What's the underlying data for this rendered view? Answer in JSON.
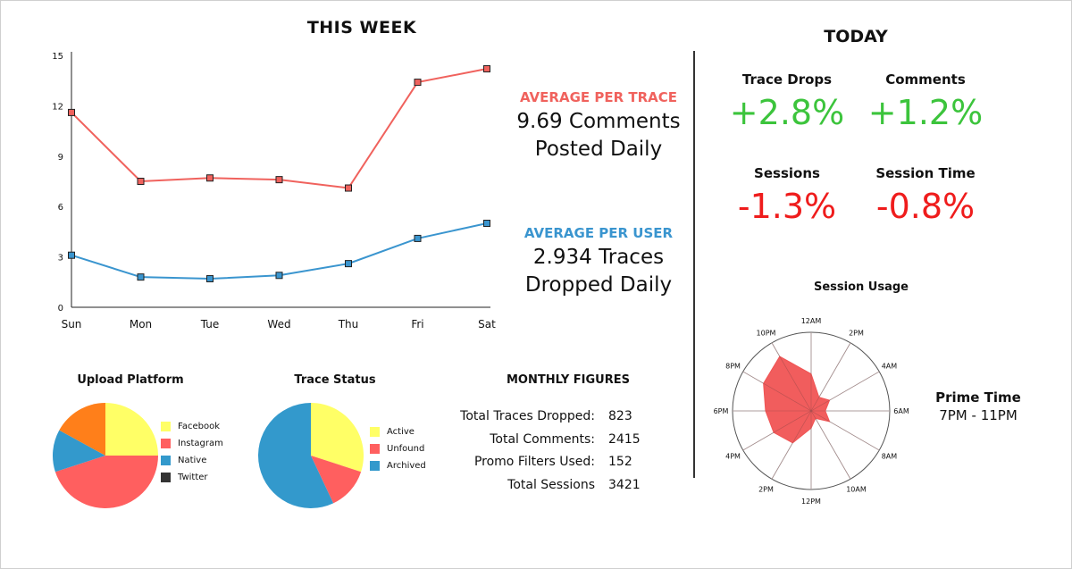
{
  "week_title": "THIS WEEK",
  "today_title": "TODAY",
  "avg_trace": {
    "label": "AVERAGE PER TRACE",
    "line1": "9.69 Comments",
    "line2": "Posted Daily",
    "color": "#f0625d"
  },
  "avg_user": {
    "label": "AVERAGE PER USER",
    "line1": "2.934 Traces",
    "line2": "Dropped Daily",
    "color": "#3a95cf"
  },
  "kpis": [
    {
      "label": "Trace Drops",
      "value": "+2.8%",
      "color": "#3cc43c"
    },
    {
      "label": "Comments",
      "value": "+1.2%",
      "color": "#3cc43c"
    },
    {
      "label": "Sessions",
      "value": "-1.3%",
      "color": "#ef1c1c"
    },
    {
      "label": "Session Time",
      "value": "-0.8%",
      "color": "#ef1c1c"
    }
  ],
  "monthly": {
    "title": "MONTHLY FIGURES",
    "rows": [
      {
        "label": "Total Traces Dropped:",
        "value": "823"
      },
      {
        "label": "Total Comments:",
        "value": "2415"
      },
      {
        "label": "Promo Filters Used:",
        "value": "152"
      },
      {
        "label": "Total Sessions",
        "value": "3421"
      }
    ]
  },
  "prime": {
    "title": "Prime Time",
    "value": "7PM - 11PM"
  },
  "chart_data": [
    {
      "type": "line",
      "categories": [
        "Sun",
        "Mon",
        "Tue",
        "Wed",
        "Thu",
        "Fri",
        "Sat"
      ],
      "y_ticks": [
        "0",
        "3",
        "6",
        "9",
        "12",
        "15"
      ],
      "ylim": [
        0,
        15
      ],
      "grid": false,
      "series": [
        {
          "values": [
            11.6,
            7.5,
            7.7,
            7.6,
            7.1,
            13.4,
            14.2
          ],
          "color": "#f0625d"
        },
        {
          "values": [
            3.1,
            1.8,
            1.7,
            1.9,
            2.6,
            4.1,
            5.0
          ],
          "color": "#3a95cf"
        }
      ]
    },
    {
      "type": "pie",
      "title": "Upload Platform",
      "labels": [
        "Facebook",
        "Instagram",
        "Native",
        "Twitter"
      ],
      "values": [
        25,
        45,
        13,
        17
      ],
      "colors": [
        "#ffff66",
        "#ff5f5f",
        "#3399cc",
        "#ff7f1a"
      ],
      "legend_colors": [
        "#ffff66",
        "#ff5f5f",
        "#3399cc",
        "#333333"
      ],
      "legend": "right"
    },
    {
      "type": "pie",
      "title": "Trace Status",
      "labels": [
        "Active",
        "Unfound",
        "Archived"
      ],
      "values": [
        30,
        13,
        57
      ],
      "colors": [
        "#ffff66",
        "#ff5f5f",
        "#3399cc"
      ],
      "legend": "right"
    },
    {
      "type": "radar",
      "title": "Session Usage",
      "labels": [
        "12AM",
        "2PM",
        "4AM",
        "6AM",
        "8AM",
        "10AM",
        "12PM",
        "2PM",
        "4PM",
        "6PM",
        "8PM",
        "10PM"
      ],
      "values": [
        0.47,
        0.2,
        0.27,
        0.18,
        0.27,
        0.11,
        0.22,
        0.47,
        0.55,
        0.58,
        0.7,
        0.8
      ],
      "rmax": 1,
      "color": "#f05454"
    }
  ]
}
